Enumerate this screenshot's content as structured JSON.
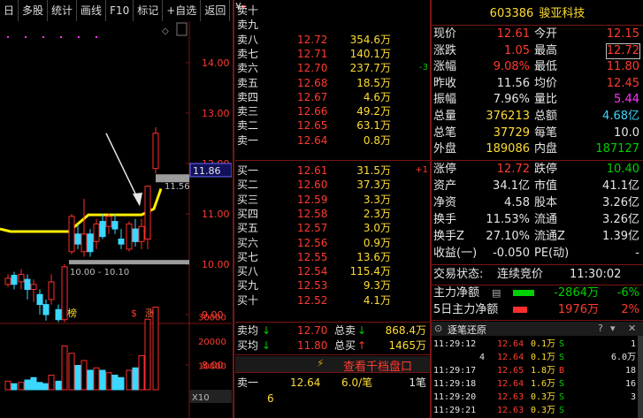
{
  "toolbar": {
    "items": [
      "日",
      "多股",
      "统计",
      "画线",
      "F10",
      "标记",
      "+自选",
      "返回"
    ]
  },
  "chart": {
    "price_ticks": [
      "14.00",
      "13.00",
      "12.00",
      "11.00",
      "10.00",
      "9.00",
      "8.00"
    ],
    "current_price_tag": "11.86",
    "ma_tag": "11.56",
    "range_label": "10.00 - 10.10",
    "markers": [
      "榜",
      "$",
      "涨"
    ],
    "vol_ticks": [
      "30000",
      "20000",
      "10000"
    ],
    "vol_unit": "X10"
  },
  "stock": {
    "code": "603386",
    "name": "骏亚科技"
  },
  "order_book": {
    "sell": [
      {
        "label": "卖十",
        "price": "",
        "vol": ""
      },
      {
        "label": "卖九",
        "price": "",
        "vol": ""
      },
      {
        "label": "卖八",
        "price": "12.72",
        "vol": "354.6万"
      },
      {
        "label": "卖七",
        "price": "12.71",
        "vol": "140.1万"
      },
      {
        "label": "卖六",
        "price": "12.70",
        "vol": "237.7万",
        "chg": "-3"
      },
      {
        "label": "卖五",
        "price": "12.68",
        "vol": "18.5万"
      },
      {
        "label": "卖四",
        "price": "12.67",
        "vol": "4.6万"
      },
      {
        "label": "卖三",
        "price": "12.66",
        "vol": "49.2万"
      },
      {
        "label": "卖二",
        "price": "12.65",
        "vol": "63.1万"
      },
      {
        "label": "卖一",
        "price": "12.64",
        "vol": "0.8万"
      }
    ],
    "buy": [
      {
        "label": "买一",
        "price": "12.61",
        "vol": "31.5万",
        "chg": "+1"
      },
      {
        "label": "买二",
        "price": "12.60",
        "vol": "37.3万"
      },
      {
        "label": "买三",
        "price": "12.59",
        "vol": "3.3万"
      },
      {
        "label": "买四",
        "price": "12.58",
        "vol": "2.3万"
      },
      {
        "label": "买五",
        "price": "12.57",
        "vol": "3.0万"
      },
      {
        "label": "买六",
        "price": "12.56",
        "vol": "0.9万"
      },
      {
        "label": "买七",
        "price": "12.55",
        "vol": "13.6万"
      },
      {
        "label": "买八",
        "price": "12.54",
        "vol": "115.4万"
      },
      {
        "label": "买九",
        "price": "12.53",
        "vol": "9.3万"
      },
      {
        "label": "买十",
        "price": "12.52",
        "vol": "4.1万"
      }
    ],
    "sell_avg_label": "卖均",
    "sell_avg": "12.70",
    "total_sell_label": "总卖",
    "total_sell": "868.4万",
    "buy_avg_label": "买均",
    "buy_avg": "11.80",
    "total_buy_label": "总买",
    "total_buy": "1465万",
    "depth_link": "查看千档盘口",
    "bottom": {
      "label": "卖一",
      "price": "12.64",
      "vol": "6.0/笔",
      "count": "1笔",
      "sub": "6"
    }
  },
  "quote": {
    "rows": [
      [
        "现价",
        "12.61",
        "今开",
        "12.15"
      ],
      [
        "涨跌",
        "1.05",
        "最高",
        "12.72"
      ],
      [
        "涨幅",
        "9.08%",
        "最低",
        "11.80"
      ],
      [
        "昨收",
        "11.56",
        "均价",
        "12.45"
      ],
      [
        "振幅",
        "7.96%",
        "量比",
        "5.44"
      ],
      [
        "总量",
        "376213",
        "总额",
        "4.68亿"
      ],
      [
        "总笔",
        "37729",
        "每笔",
        "10.0"
      ],
      [
        "外盘",
        "189086",
        "内盘",
        "187127"
      ]
    ],
    "rows2": [
      [
        "涨停",
        "12.72",
        "跌停",
        "10.40"
      ],
      [
        "资产",
        "34.1亿",
        "市值",
        "41.1亿"
      ],
      [
        "净资",
        "4.58",
        "股本",
        "3.26亿"
      ],
      [
        "换手",
        "11.53%",
        "流通",
        "3.26亿"
      ],
      [
        "换手Z",
        "27.10%",
        "流通Z",
        "1.39亿"
      ],
      [
        "收益(一)",
        "-0.050",
        "PE(动)",
        "-"
      ]
    ],
    "status_label": "交易状态:",
    "status": "连续竞价",
    "status_time": "11:30:02",
    "main_net_label": "主力净额",
    "main_net": "-2864万",
    "main_net_pct": "-6%",
    "five_day_label": "5日主力净额",
    "five_day": "1976万",
    "five_day_pct": "2%"
  },
  "trades": {
    "title": "逐笔还原",
    "rows": [
      {
        "time": "11:29:12",
        "n": "",
        "price": "12.64",
        "vol": "0.1万",
        "side": "S",
        "cnt": "1"
      },
      {
        "time": "",
        "n": "4",
        "price": "12.64",
        "vol": "0.1万",
        "side": "S",
        "cnt": "6.0万"
      },
      {
        "time": "11:29:17",
        "n": "",
        "price": "12.65",
        "vol": "1.8万",
        "side": "B",
        "cnt": "18"
      },
      {
        "time": "11:29:18",
        "n": "",
        "price": "12.64",
        "vol": "1.6万",
        "side": "S",
        "cnt": "16"
      },
      {
        "time": "11:29:20",
        "n": "",
        "price": "12.63",
        "vol": "0.3万",
        "side": "S",
        "cnt": "3"
      },
      {
        "time": "11:29:21",
        "n": "",
        "price": "12.63",
        "vol": "0.3万",
        "side": "S",
        "cnt": ""
      }
    ]
  }
}
